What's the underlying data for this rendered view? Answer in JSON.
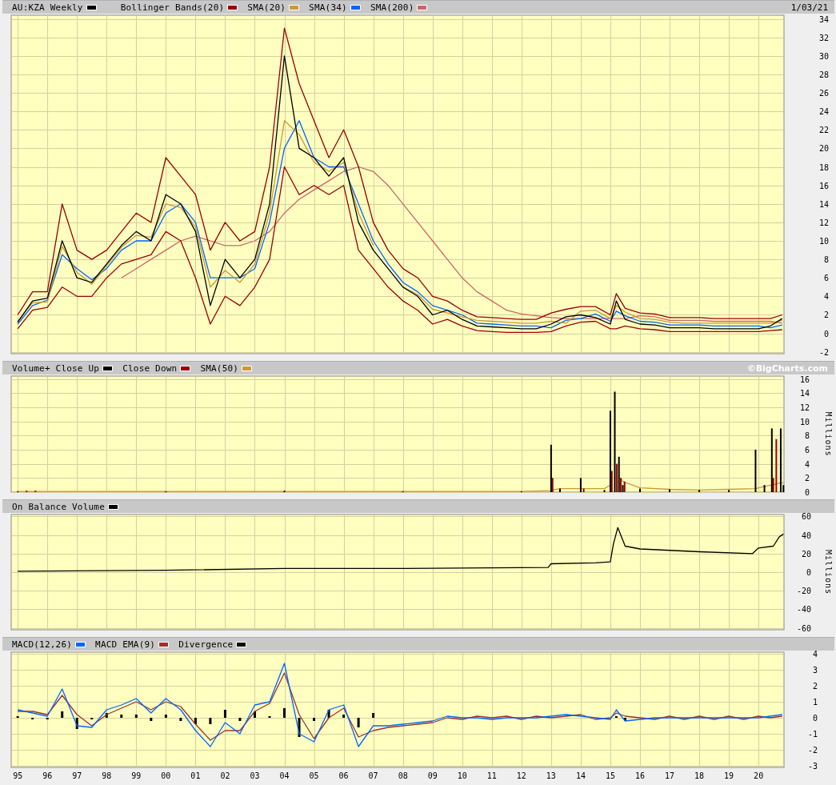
{
  "panels": [
    {
      "kind": "price",
      "date": "1/03/21",
      "chart_data": {
        "type": "line",
        "grid": true,
        "xlim": [
          1994.78,
          2020.86
        ],
        "ylim": [
          -2.2,
          34.4
        ],
        "yticks": [
          -2,
          0,
          2,
          4,
          6,
          8,
          10,
          12,
          14,
          16,
          18,
          20,
          22,
          24,
          26,
          28,
          30,
          32,
          34
        ],
        "x": [
          1995.0,
          1995.5,
          1996.0,
          1996.5,
          1997.0,
          1997.5,
          1998.0,
          1998.5,
          1999.0,
          1999.5,
          2000.0,
          2000.5,
          2001.0,
          2001.5,
          2002.0,
          2002.5,
          2003.0,
          2003.5,
          2004.0,
          2004.5,
          2005.0,
          2005.5,
          2006.0,
          2006.5,
          2007.0,
          2007.5,
          2008.0,
          2008.5,
          2009.0,
          2009.5,
          2010.0,
          2010.5,
          2011.0,
          2011.5,
          2012.0,
          2012.5,
          2013.0,
          2013.5,
          2014.0,
          2014.5,
          2015.0,
          2015.2,
          2015.5,
          2016.0,
          2016.5,
          2017.0,
          2017.5,
          2018.0,
          2018.5,
          2019.0,
          2019.5,
          2020.0,
          2020.4,
          2020.8
        ],
        "series": [
          {
            "name": "AU:KZA Weekly",
            "color": "#000000",
            "values": [
              1.2,
              3.5,
              3.8,
              10,
              6,
              5.5,
              7.5,
              9.5,
              11,
              10,
              15,
              14,
              11,
              3,
              8,
              6,
              8,
              14,
              30,
              20,
              19,
              17,
              19,
              12,
              9,
              7,
              5,
              4,
              2,
              2.5,
              1.5,
              0.8,
              0.7,
              0.6,
              0.5,
              0.5,
              1.0,
              1.8,
              2.0,
              1.7,
              1.0,
              3.5,
              1.5,
              1.0,
              0.9,
              0.6,
              0.6,
              0.6,
              0.5,
              0.5,
              0.5,
              0.5,
              0.8,
              1.6
            ]
          },
          {
            "name": "Bollinger Bands(20)",
            "color": "#990000",
            "values": [
              2,
              4.5,
              4.5,
              14,
              9,
              8,
              9,
              11,
              13,
              12,
              19,
              17,
              15,
              9,
              12,
              10,
              11,
              18,
              33,
              27,
              23,
              19,
              22,
              18,
              12,
              9,
              7,
              6,
              4,
              3.5,
              2.5,
              1.8,
              1.7,
              1.6,
              1.5,
              1.5,
              2.2,
              2.6,
              2.9,
              2.9,
              2.0,
              4.3,
              2.7,
              2.2,
              2.1,
              1.7,
              1.7,
              1.7,
              1.6,
              1.6,
              1.6,
              1.6,
              1.6,
              2.0
            ]
          },
          {
            "color": "#990000",
            "values": [
              0.5,
              2.5,
              2.8,
              5,
              4,
              4,
              6,
              7.5,
              8,
              8.5,
              11,
              10,
              6,
              1,
              4,
              3,
              5,
              8,
              18,
              15,
              16,
              15,
              16,
              9,
              7,
              5,
              3.5,
              2.5,
              1,
              1.5,
              0.8,
              0.3,
              0.2,
              0.1,
              0.1,
              0.1,
              0.2,
              0.8,
              1.2,
              1.3,
              0.5,
              0.5,
              0.8,
              0.5,
              0.4,
              0.2,
              0.2,
              0.2,
              0.2,
              0.2,
              0.2,
              0.2,
              0.3,
              0.4
            ]
          },
          {
            "name": "SMA(20)",
            "color": "#cc9933",
            "values": [
              1.3,
              3.3,
              3.4,
              9.4,
              6.6,
              5.3,
              7.3,
              9.3,
              10.6,
              10.4,
              14,
              13.6,
              11.5,
              5,
              6.8,
              5.5,
              7.5,
              13,
              23,
              21.5,
              18.5,
              17.5,
              18.5,
              13,
              9.5,
              null,
              5,
              4.2,
              2.6,
              2.2,
              1.8,
              1.4,
              1.3,
              1.2,
              1.1,
              1.1,
              1.3,
              1.1,
              2.4,
              2.5,
              1.6,
              3.0,
              2.3,
              1.6,
              1.5,
              1.2,
              1.1,
              1.1,
              1.1,
              1.1,
              1.1,
              1.1,
              1.1,
              1.4
            ]
          },
          {
            "name": "SMA(34)",
            "color": "#0066ff",
            "values": [
              1,
              3,
              3.6,
              8.5,
              7,
              5.8,
              7,
              9,
              10,
              10,
              13,
              14,
              12,
              6,
              6,
              6,
              7,
              12,
              20,
              23,
              19,
              18,
              18,
              14,
              10,
              7.5,
              5.5,
              4.5,
              3,
              2.5,
              2,
              1.1,
              1.0,
              0.9,
              0.8,
              0.8,
              0.6,
              1.4,
              1.6,
              2.1,
              1.3,
              2.4,
              1.9,
              1.3,
              1.2,
              0.9,
              0.9,
              0.9,
              0.8,
              0.8,
              0.8,
              0.8,
              0.6,
              0.9
            ]
          },
          {
            "name": "SMA(200)",
            "color": "#cc6666",
            "values": [
              null,
              null,
              null,
              null,
              null,
              null,
              null,
              6,
              7,
              8,
              9,
              10,
              10.5,
              10,
              9.5,
              9.5,
              10,
              11,
              13,
              14.5,
              15.5,
              16.5,
              17.5,
              18,
              17.5,
              16,
              14,
              12,
              10,
              8,
              6,
              4.5,
              3.5,
              2.5,
              2.1,
              1.9,
              1.7,
              1.6,
              1.6,
              1.6,
              1.6,
              1.6,
              1.6,
              1.9,
              1.8,
              1.4,
              1.4,
              1.4,
              1.3,
              1.3,
              1.3,
              1.3,
              1.3,
              1.1
            ]
          }
        ]
      }
    },
    {
      "kind": "volume",
      "credit": "©BigCharts.com",
      "axis_unit": "Millions",
      "chart_data": {
        "type": "bar",
        "grid": true,
        "xlim": [
          1994.78,
          2020.86
        ],
        "ylim": [
          0,
          16.4
        ],
        "yticks": [
          0,
          2,
          4,
          6,
          8,
          10,
          12,
          14,
          16
        ],
        "x": [
          1995,
          1995.3,
          1995.6,
          2000,
          2004,
          2008,
          2012,
          2013.0,
          2013.05,
          2013.3,
          2014.0,
          2014.1,
          2014.8,
          2015.0,
          2015.05,
          2015.15,
          2015.22,
          2015.29,
          2015.35,
          2015.42,
          2015.48,
          2016,
          2017,
          2018,
          2019,
          2019.9,
          2020.2,
          2020.45,
          2020.5,
          2020.6,
          2020.75,
          2020.84
        ],
        "series": [
          {
            "name": "Volume+ Close Up",
            "color": "#000000",
            "values": [
              0.1,
              null,
              null,
              0.1,
              0.2,
              0.1,
              0.1,
              6.7,
              null,
              0.5,
              2,
              null,
              0.3,
              11.5,
              null,
              14.2,
              null,
              5,
              null,
              1,
              null,
              0.5,
              0.4,
              0.3,
              0.3,
              6,
              1,
              9,
              null,
              null,
              9,
              1
            ]
          },
          {
            "name": "Close Down",
            "color": "#990000",
            "values": [
              null,
              0.2,
              0.2,
              null,
              null,
              null,
              null,
              null,
              2,
              null,
              null,
              0.5,
              null,
              null,
              3,
              null,
              4,
              null,
              2,
              null,
              1.5,
              null,
              null,
              null,
              null,
              null,
              null,
              null,
              2,
              7.5,
              null,
              null
            ]
          },
          {
            "name": "SMA(50)",
            "color": "#cc9933",
            "type": "line",
            "values": [
              0.1,
              0.1,
              0.1,
              0.1,
              0.1,
              0.1,
              0.1,
              0.2,
              0.3,
              0.5,
              0.5,
              0.5,
              0.5,
              1,
              null,
              null,
              null,
              2,
              2,
              1.5,
              1.4,
              0.6,
              0.4,
              0.3,
              0.4,
              0.5,
              0.8,
              1,
              1,
              1.2,
              1.3,
              1.3
            ]
          }
        ]
      }
    },
    {
      "kind": "obv",
      "axis_unit": "Millions",
      "chart_data": {
        "type": "line",
        "grid": true,
        "xlim": [
          1994.78,
          2020.86
        ],
        "ylim": [
          -62,
          62
        ],
        "yticks": [
          -60,
          -40,
          -20,
          0,
          20,
          40,
          60
        ],
        "x": [
          1995,
          2000,
          2004,
          2008,
          2012.9,
          2013.0,
          2014.5,
          2015.0,
          2015.1,
          2015.25,
          2015.5,
          2016,
          2018,
          2019.8,
          2020.0,
          2020.5,
          2020.7,
          2020.84
        ],
        "series": [
          {
            "name": "On Balance Volume",
            "color": "#000000",
            "values": [
              1,
              2,
              4,
              4,
              5,
              9,
              10,
              11,
              30,
              48,
              28,
              25,
              22,
              20,
              26,
              28,
              38,
              41
            ]
          }
        ]
      }
    },
    {
      "kind": "macd",
      "chart_data": {
        "type": "line",
        "grid": true,
        "xlim": [
          1994.78,
          2020.86
        ],
        "ylim": [
          -3.1,
          4.1
        ],
        "yticks": [
          -3,
          -2,
          -1,
          0,
          1,
          2,
          3,
          4
        ],
        "xticks": [
          {
            "value": 1995,
            "label": "95"
          },
          {
            "value": 1996,
            "label": "96"
          },
          {
            "value": 1997,
            "label": "97"
          },
          {
            "value": 1998,
            "label": "98"
          },
          {
            "value": 1999,
            "label": "99"
          },
          {
            "value": 2000,
            "label": "00"
          },
          {
            "value": 2001,
            "label": "01"
          },
          {
            "value": 2002,
            "label": "02"
          },
          {
            "value": 2003,
            "label": "03"
          },
          {
            "value": 2004,
            "label": "04"
          },
          {
            "value": 2005,
            "label": "05"
          },
          {
            "value": 2006,
            "label": "06"
          },
          {
            "value": 2007,
            "label": "07"
          },
          {
            "value": 2008,
            "label": "08"
          },
          {
            "value": 2009,
            "label": "09"
          },
          {
            "value": 2010,
            "label": "10"
          },
          {
            "value": 2011,
            "label": "11"
          },
          {
            "value": 2012,
            "label": "12"
          },
          {
            "value": 2013,
            "label": "13"
          },
          {
            "value": 2014,
            "label": "14"
          },
          {
            "value": 2015,
            "label": "15"
          },
          {
            "value": 2016,
            "label": "16"
          },
          {
            "value": 2017,
            "label": "17"
          },
          {
            "value": 2018,
            "label": "18"
          },
          {
            "value": 2019,
            "label": "19"
          },
          {
            "value": 2020,
            "label": "20"
          }
        ],
        "x": [
          1995.0,
          1995.5,
          1996.0,
          1996.5,
          1997.0,
          1997.5,
          1998.0,
          1998.5,
          1999.0,
          1999.5,
          2000.0,
          2000.5,
          2001.0,
          2001.5,
          2002.0,
          2002.5,
          2003.0,
          2003.5,
          2004.0,
          2004.5,
          2005.0,
          2005.5,
          2006.0,
          2006.5,
          2007.0,
          2007.5,
          2008.0,
          2008.5,
          2009.0,
          2009.5,
          2010.0,
          2010.5,
          2011.0,
          2011.5,
          2012.0,
          2012.5,
          2013.0,
          2013.5,
          2014.0,
          2014.5,
          2015.0,
          2015.2,
          2015.5,
          2016.0,
          2016.5,
          2017.0,
          2017.5,
          2018.0,
          2018.5,
          2019.0,
          2019.5,
          2020.0,
          2020.4,
          2020.8
        ],
        "series": [
          {
            "name": "MACD(12,26)",
            "color": "#0066ff",
            "values": [
              0.5,
              0.3,
              0.1,
              1.8,
              -0.5,
              -0.6,
              0.5,
              0.8,
              1.2,
              0.3,
              1.2,
              0.5,
              -0.8,
              -1.8,
              -0.3,
              -1.0,
              0.8,
              1.0,
              3.4,
              -1.0,
              -1.5,
              0.5,
              0.8,
              -1.8,
              -0.5,
              -0.5,
              -0.4,
              -0.3,
              -0.2,
              0.1,
              0,
              0,
              -0.1,
              0,
              0,
              0,
              0.1,
              0.2,
              0.1,
              0,
              -0.1,
              0.5,
              -0.2,
              -0.1,
              0,
              0,
              0,
              0,
              0,
              0,
              0,
              0,
              0.1,
              0.2
            ]
          },
          {
            "name": "MACD EMA(9)",
            "color": "#993333",
            "values": [
              0.4,
              0.4,
              0.2,
              1.4,
              0.2,
              -0.5,
              0.2,
              0.6,
              1.0,
              0.5,
              1.0,
              0.7,
              -0.4,
              -1.4,
              -0.8,
              -0.8,
              0.4,
              0.9,
              2.8,
              0.2,
              -1.3,
              0,
              0.6,
              -1.2,
              -0.8,
              -0.6,
              -0.5,
              -0.4,
              -0.3,
              0,
              -0.1,
              0.1,
              0,
              0.1,
              -0.1,
              0.1,
              0,
              0.1,
              0.2,
              -0.1,
              0,
              0.3,
              0.1,
              0,
              -0.1,
              0.1,
              -0.1,
              0.1,
              -0.1,
              0.1,
              -0.1,
              0.1,
              0,
              0.1
            ]
          },
          {
            "name": "Divergence",
            "color": "#000000",
            "type": "bar",
            "values": [
              0.1,
              -0.1,
              -0.1,
              0.4,
              -0.7,
              -0.1,
              0.3,
              0.2,
              0.2,
              -0.2,
              0.2,
              -0.2,
              -0.4,
              -0.4,
              0.5,
              -0.2,
              0.4,
              0.1,
              0.6,
              -1.2,
              -0.2,
              0.5,
              0.2,
              -0.6,
              0.3,
              null,
              null,
              null,
              null,
              null,
              null,
              null,
              null,
              null,
              null,
              null,
              null,
              null,
              null,
              null,
              null,
              0.1,
              -0.2,
              null,
              null,
              null,
              null,
              null,
              null,
              null,
              null,
              null,
              null,
              null
            ]
          }
        ]
      }
    }
  ]
}
